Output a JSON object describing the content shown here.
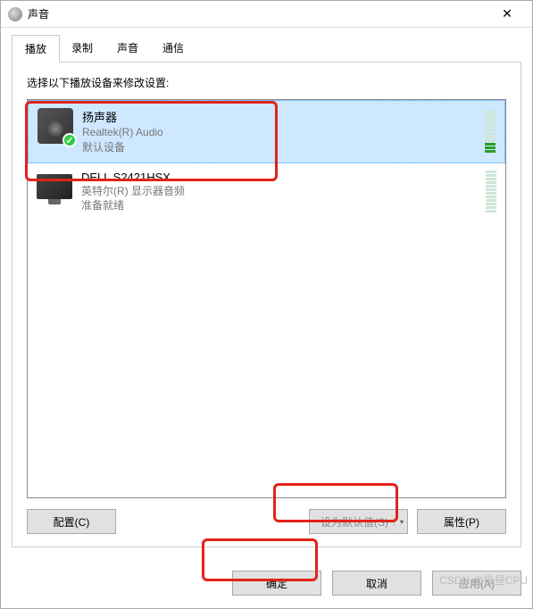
{
  "window": {
    "title": "声音"
  },
  "tabs": [
    {
      "label": "播放",
      "active": true
    },
    {
      "label": "录制",
      "active": false
    },
    {
      "label": "声音",
      "active": false
    },
    {
      "label": "通信",
      "active": false
    }
  ],
  "instruction": "选择以下播放设备来修改设置:",
  "devices": [
    {
      "name": "扬声器",
      "subtitle": "Realtek(R) Audio",
      "status": "默认设备",
      "selected": true,
      "default_badge": true,
      "icon": "speaker",
      "level_active": 3,
      "level_total": 12
    },
    {
      "name": "DELL S2421HSX",
      "subtitle": "英特尔(R) 显示器音频",
      "status": "准备就绪",
      "selected": false,
      "default_badge": false,
      "icon": "monitor",
      "level_active": 0,
      "level_total": 12
    }
  ],
  "buttons": {
    "configure": "配置(C)",
    "set_default": "设为默认值(S)",
    "properties": "属性(P)",
    "ok": "确定",
    "cancel": "取消",
    "apply": "应用(A)"
  },
  "watermark": "CSDN @极昼CPU"
}
